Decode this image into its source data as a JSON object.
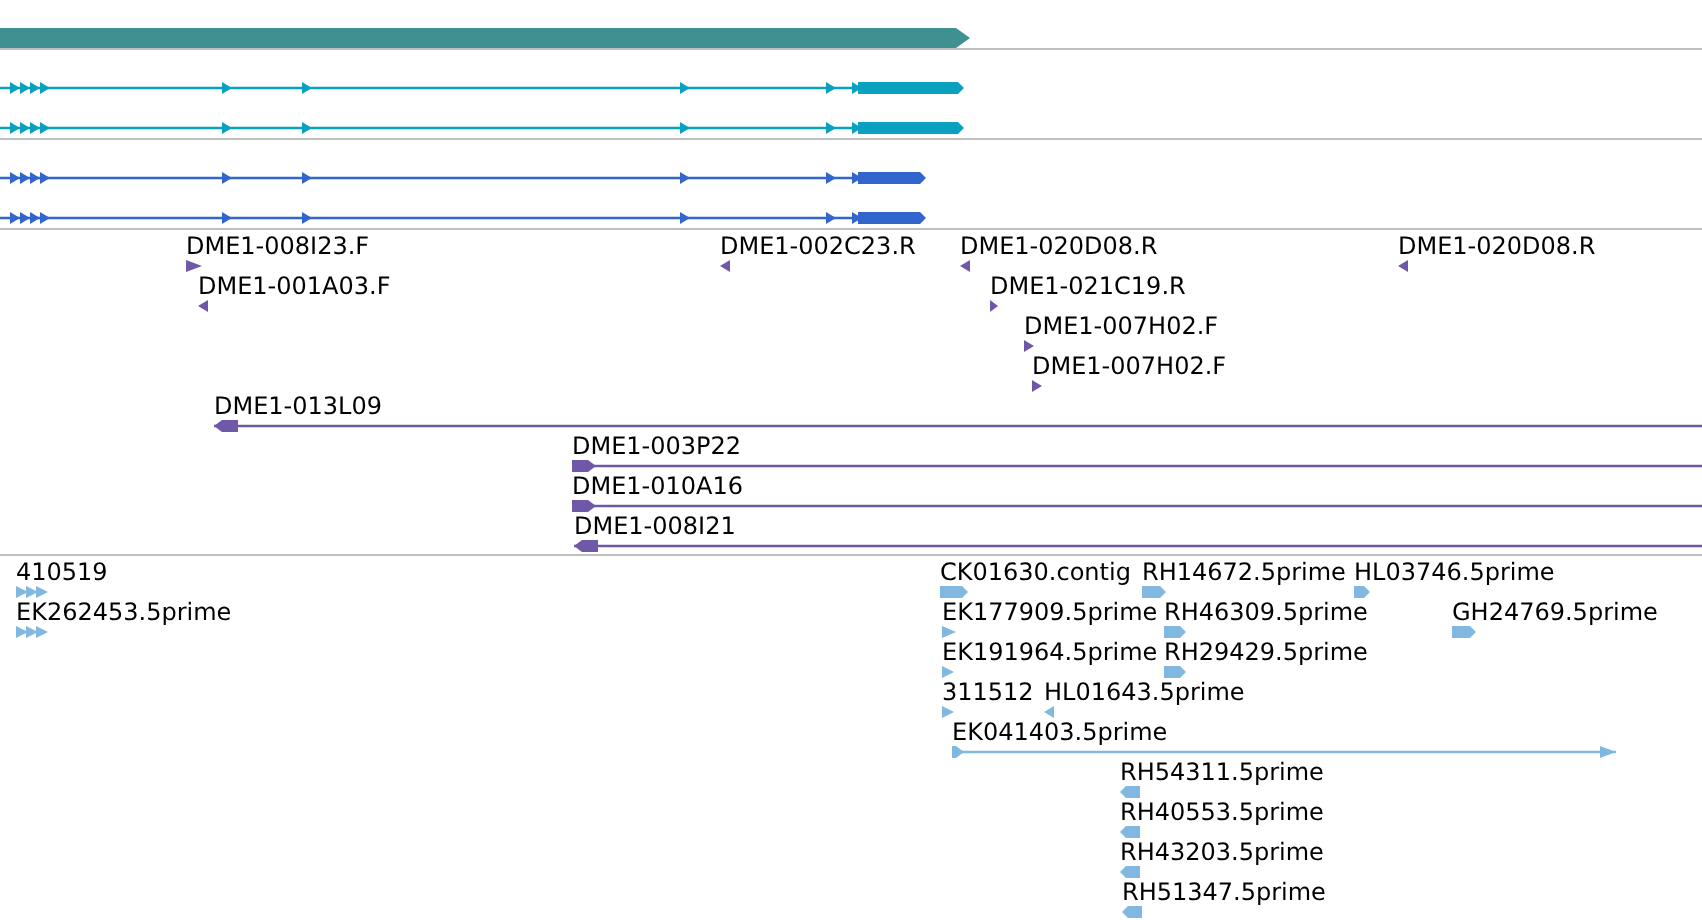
{
  "tracks": [
    {
      "kind": "gene",
      "features": [
        {
          "reverse": false
        }
      ]
    },
    {
      "kind": "transcript",
      "features": [
        {
          "reverse": false
        },
        {
          "reverse": false
        }
      ]
    },
    {
      "kind": "transcript",
      "features": [
        {
          "reverse": false
        },
        {
          "reverse": false
        }
      ]
    },
    {
      "kind": "labeled",
      "features": [
        {
          "label": "DME1-008I23.F",
          "reverse": false
        },
        {
          "label": "DME1-002C23.R",
          "reverse": true
        },
        {
          "label": "DME1-020D08.R",
          "reverse": true
        },
        {
          "label": "DME1-020D08.R",
          "reverse": true
        },
        {
          "label": "DME1-001A03.F",
          "reverse": true
        },
        {
          "label": "DME1-021C19.R",
          "reverse": false
        },
        {
          "label": "DME1-007H02.F",
          "reverse": false
        },
        {
          "label": "DME1-007H02.F",
          "reverse": false
        },
        {
          "label": "DME1-013L09",
          "reverse": true
        },
        {
          "label": "DME1-003P22",
          "reverse": false
        },
        {
          "label": "DME1-010A16",
          "reverse": false
        },
        {
          "label": "DME1-008I21",
          "reverse": true
        }
      ]
    },
    {
      "kind": "labeled",
      "features": [
        {
          "label": "410519",
          "reverse": false
        },
        {
          "label": "CK01630.contig",
          "reverse": false
        },
        {
          "label": "RH14672.5prime",
          "reverse": false
        },
        {
          "label": "HL03746.5prime",
          "reverse": false
        },
        {
          "label": "EK262453.5prime",
          "reverse": false
        },
        {
          "label": "EK177909.5prime",
          "reverse": false
        },
        {
          "label": "RH46309.5prime",
          "reverse": false
        },
        {
          "label": "GH24769.5prime",
          "reverse": false
        },
        {
          "label": "EK191964.5prime",
          "reverse": false
        },
        {
          "label": "RH29429.5prime",
          "reverse": false
        },
        {
          "label": "311512",
          "reverse": false
        },
        {
          "label": "HL01643.5prime",
          "reverse": true
        },
        {
          "label": "EK041403.5prime",
          "reverse": false
        },
        {
          "label": "RH54311.5prime",
          "reverse": true
        },
        {
          "label": "RH40553.5prime",
          "reverse": true
        },
        {
          "label": "RH43203.5prime",
          "reverse": true
        },
        {
          "label": "RH51347.5prime",
          "reverse": true
        }
      ]
    }
  ]
}
